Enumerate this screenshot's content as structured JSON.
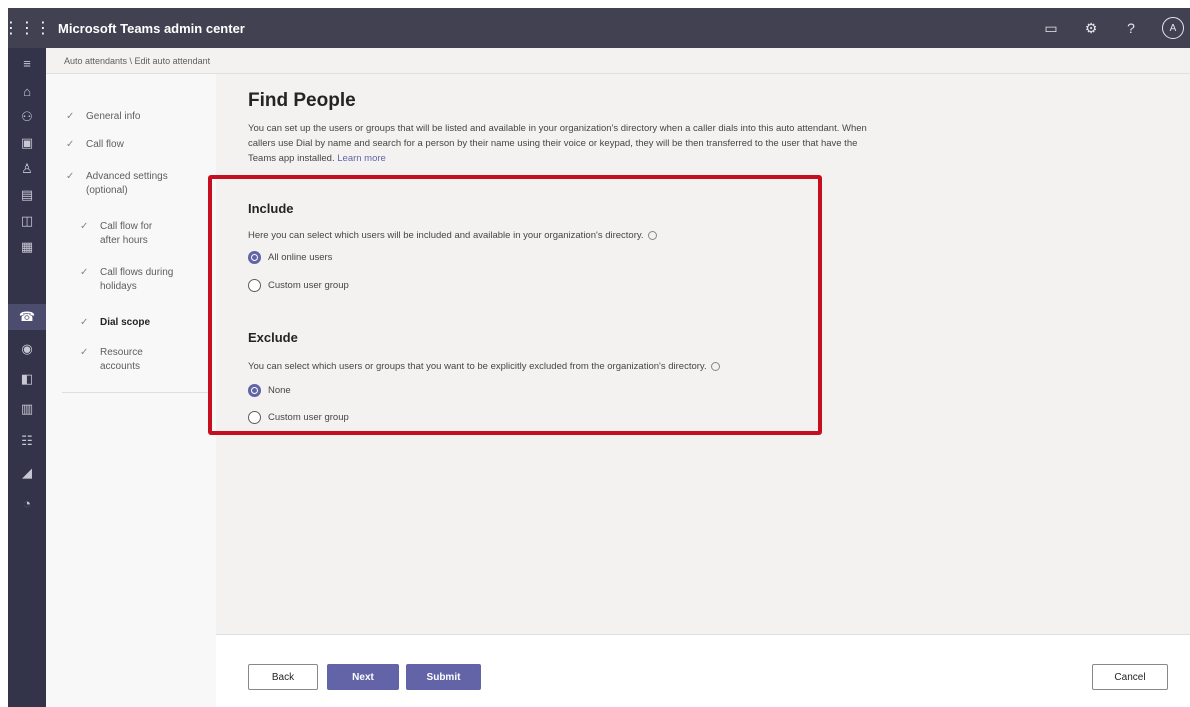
{
  "app": {
    "title": "Microsoft Teams admin center"
  },
  "topbar_icons": [
    "screen-icon",
    "gear-icon",
    "help-icon"
  ],
  "user": {
    "initials": "A"
  },
  "breadcrumb": "Auto attendants \\ Edit auto attendant",
  "steps": [
    {
      "label": "General info"
    },
    {
      "label": "Call flow"
    },
    {
      "label": "Advanced settings (optional)"
    },
    {
      "label": "Call flow for after hours"
    },
    {
      "label": "Call flows during holidays"
    },
    {
      "label": "Dial scope"
    },
    {
      "label": "Resource accounts"
    }
  ],
  "page": {
    "title": "Find People",
    "description": "You can set up the users or groups that will be listed and available in your organization's directory when a caller dials into this auto attendant. When callers use Dial by name and search for a person by their name using their voice or keypad, they will be then transferred to the user that have the Teams app installed.",
    "learn_more": "Learn more"
  },
  "include": {
    "title": "Include",
    "description": "Here you can select which users will be included and available in your organization's directory.",
    "options": [
      "All online users",
      "Custom user group"
    ],
    "selected": "All online users"
  },
  "exclude": {
    "title": "Exclude",
    "description": "You can select which users or groups that you want to be explicitly excluded from the organization's directory.",
    "options": [
      "None",
      "Custom user group"
    ],
    "selected": "None"
  },
  "footer": {
    "back": "Back",
    "next": "Next",
    "submit": "Submit",
    "cancel": "Cancel"
  },
  "colors": {
    "accent": "#6264a7",
    "highlight": "#c50f1f",
    "topbar": "#414151",
    "rail": "#33344a"
  }
}
